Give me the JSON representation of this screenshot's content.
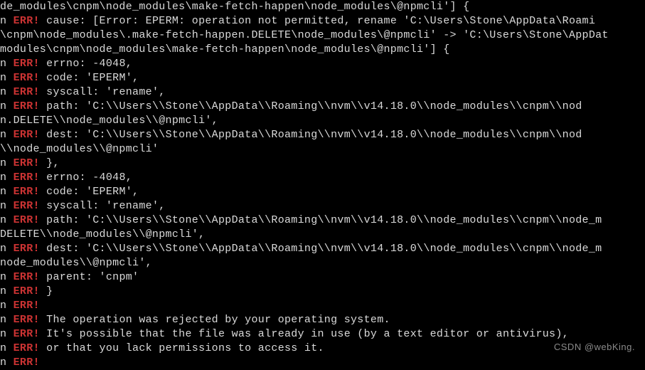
{
  "watermark": "CSDN @webKing.",
  "lines": [
    {
      "prefix": "",
      "err": "",
      "sep": "",
      "rest": "de_modules\\cnpm\\node_modules\\make-fetch-happen\\node_modules\\@npmcli'] {"
    },
    {
      "prefix": "n ",
      "err": "ERR!",
      "sep": "   ",
      "rest": "cause: [Error: EPERM: operation not permitted, rename 'C:\\Users\\Stone\\AppData\\Roami"
    },
    {
      "prefix": "",
      "err": "",
      "sep": "",
      "rest": "\\cnpm\\node_modules\\.make-fetch-happen.DELETE\\node_modules\\@npmcli' -> 'C:\\Users\\Stone\\AppDat"
    },
    {
      "prefix": "",
      "err": "",
      "sep": "",
      "rest": "modules\\cnpm\\node_modules\\make-fetch-happen\\node_modules\\@npmcli'] {"
    },
    {
      "prefix": "n ",
      "err": "ERR!",
      "sep": "     ",
      "rest": "errno: -4048,"
    },
    {
      "prefix": "n ",
      "err": "ERR!",
      "sep": "     ",
      "rest": "code: 'EPERM',"
    },
    {
      "prefix": "n ",
      "err": "ERR!",
      "sep": "     ",
      "rest": "syscall: 'rename',"
    },
    {
      "prefix": "n ",
      "err": "ERR!",
      "sep": "     ",
      "rest": "path: 'C:\\\\Users\\\\Stone\\\\AppData\\\\Roaming\\\\nvm\\\\v14.18.0\\\\node_modules\\\\cnpm\\\\nod"
    },
    {
      "prefix": "",
      "err": "",
      "sep": "",
      "rest": "n.DELETE\\\\node_modules\\\\@npmcli',"
    },
    {
      "prefix": "n ",
      "err": "ERR!",
      "sep": "     ",
      "rest": "dest: 'C:\\\\Users\\\\Stone\\\\AppData\\\\Roaming\\\\nvm\\\\v14.18.0\\\\node_modules\\\\cnpm\\\\nod"
    },
    {
      "prefix": "",
      "err": "",
      "sep": "",
      "rest": "\\\\node_modules\\\\@npmcli'"
    },
    {
      "prefix": "n ",
      "err": "ERR!",
      "sep": "   ",
      "rest": "},"
    },
    {
      "prefix": "n ",
      "err": "ERR!",
      "sep": "   ",
      "rest": "errno: -4048,"
    },
    {
      "prefix": "n ",
      "err": "ERR!",
      "sep": "   ",
      "rest": "code: 'EPERM',"
    },
    {
      "prefix": "n ",
      "err": "ERR!",
      "sep": "   ",
      "rest": "syscall: 'rename',"
    },
    {
      "prefix": "n ",
      "err": "ERR!",
      "sep": "   ",
      "rest": "path: 'C:\\\\Users\\\\Stone\\\\AppData\\\\Roaming\\\\nvm\\\\v14.18.0\\\\node_modules\\\\cnpm\\\\node_m"
    },
    {
      "prefix": "",
      "err": "",
      "sep": "",
      "rest": "DELETE\\\\node_modules\\\\@npmcli',"
    },
    {
      "prefix": "n ",
      "err": "ERR!",
      "sep": "   ",
      "rest": "dest: 'C:\\\\Users\\\\Stone\\\\AppData\\\\Roaming\\\\nvm\\\\v14.18.0\\\\node_modules\\\\cnpm\\\\node_m"
    },
    {
      "prefix": "",
      "err": "",
      "sep": "",
      "rest": "node_modules\\\\@npmcli',"
    },
    {
      "prefix": "n ",
      "err": "ERR!",
      "sep": "   ",
      "rest": "parent: 'cnpm'"
    },
    {
      "prefix": "n ",
      "err": "ERR!",
      "sep": " ",
      "rest": "}"
    },
    {
      "prefix": "n ",
      "err": "ERR!",
      "sep": "",
      "rest": ""
    },
    {
      "prefix": "n ",
      "err": "ERR!",
      "sep": " ",
      "rest": "The operation was rejected by your operating system."
    },
    {
      "prefix": "n ",
      "err": "ERR!",
      "sep": " ",
      "rest": "It's possible that the file was already in use (by a text editor or antivirus),"
    },
    {
      "prefix": "n ",
      "err": "ERR!",
      "sep": " ",
      "rest": "or that you lack permissions to access it."
    },
    {
      "prefix": "n ",
      "err": "ERR!",
      "sep": "",
      "rest": ""
    }
  ]
}
